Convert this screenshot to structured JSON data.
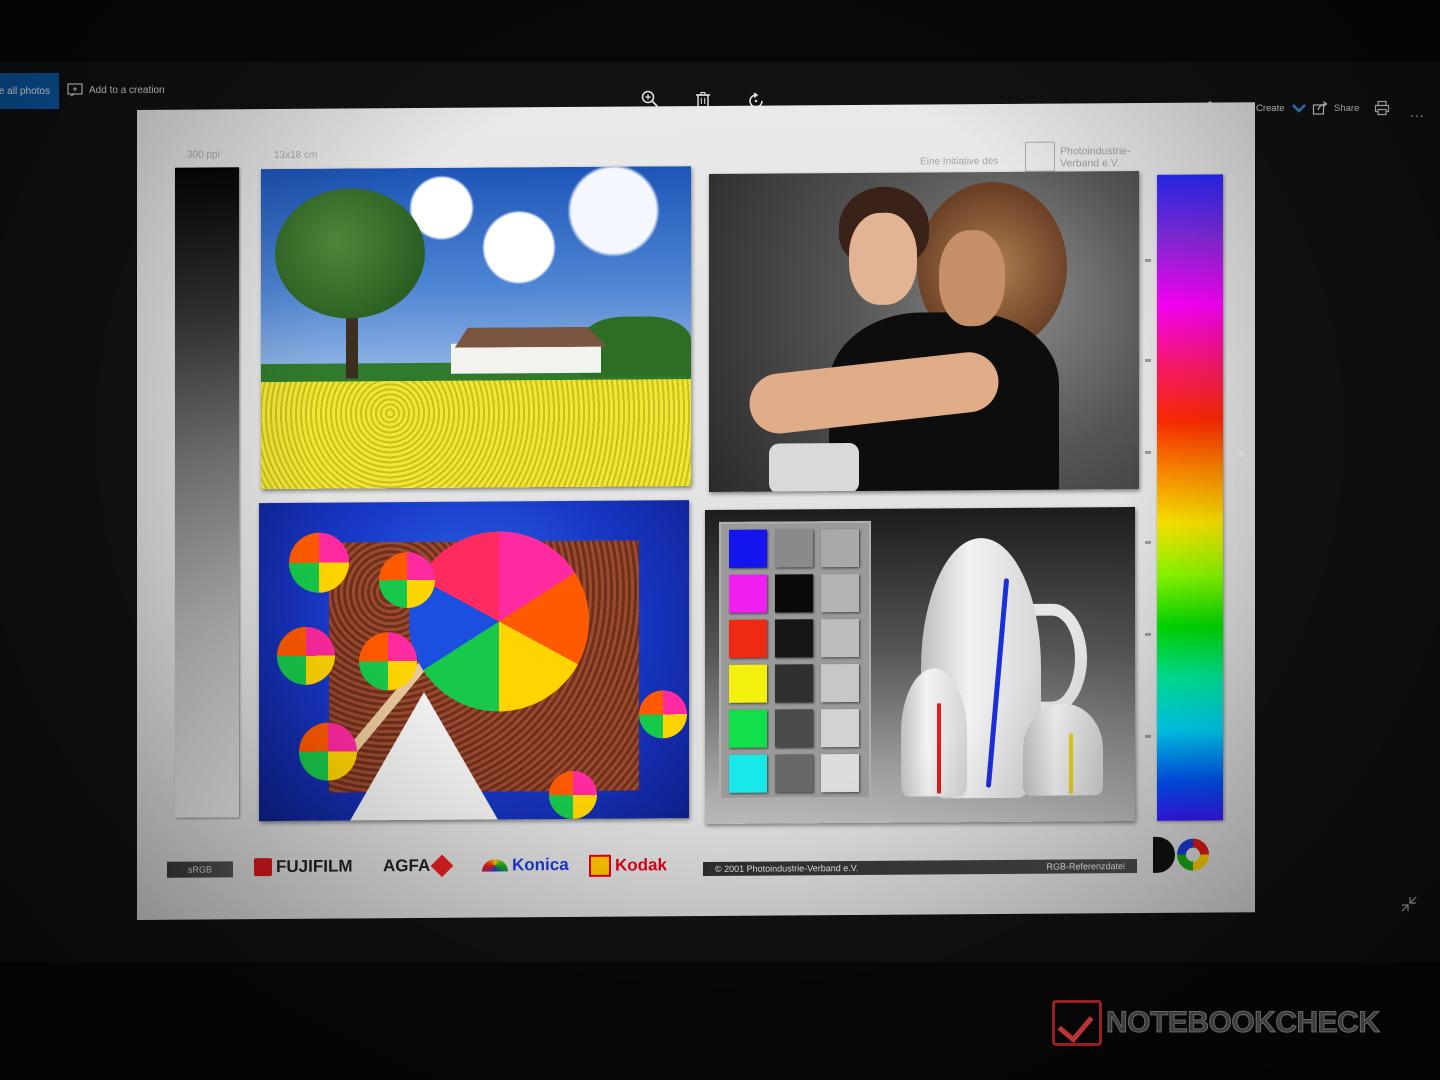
{
  "toolbar": {
    "see_all_label": "See all photos",
    "add_creation_label": "Add to a creation",
    "edit_create_label": "Edit & Create",
    "share_label": "Share",
    "more_label": "..."
  },
  "icons": {
    "add_creation": "add-to-creation-icon",
    "zoom": "zoom-in-icon",
    "delete": "delete-icon",
    "rotate": "rotate-icon",
    "edit": "edit-create-icon",
    "chevron": "chevron-down-icon",
    "share": "share-icon",
    "print": "print-icon",
    "more": "more-icon",
    "collapse": "collapse-icon"
  },
  "chart": {
    "ppi_label": "300 ppi",
    "size_label": "13x18 cm",
    "initiative_label": "Eine Initiative des",
    "org_name_line1": "Photoindustrie-",
    "org_name_line2": "Verband e.V.",
    "srgb_label": "sRGB",
    "brands": {
      "fujifilm": "FUJIFILM",
      "agfa": "AGFA",
      "konica": "Konica",
      "kodak": "Kodak"
    },
    "copyright": "© 2001  Photoindustrie-Verband e.V.",
    "reference_label": "RGB-Referenzdatei",
    "logo_text": "DQ"
  },
  "colors": {
    "accent": "#0b5cad",
    "swatches": [
      [
        "#1414ee",
        "#8a8a8a",
        "#a9a9a9"
      ],
      [
        "#f01ff0",
        "#0a0a0a",
        "#b3b3b3"
      ],
      [
        "#ee2a12",
        "#161616",
        "#bdbdbd"
      ],
      [
        "#f4f00e",
        "#303030",
        "#c7c7c7"
      ],
      [
        "#12e04a",
        "#4a4a4a",
        "#d2d2d2"
      ],
      [
        "#18e8e8",
        "#686868",
        "#dddddd"
      ]
    ]
  },
  "watermark": {
    "text": "NOTEBOOKCHECK"
  }
}
